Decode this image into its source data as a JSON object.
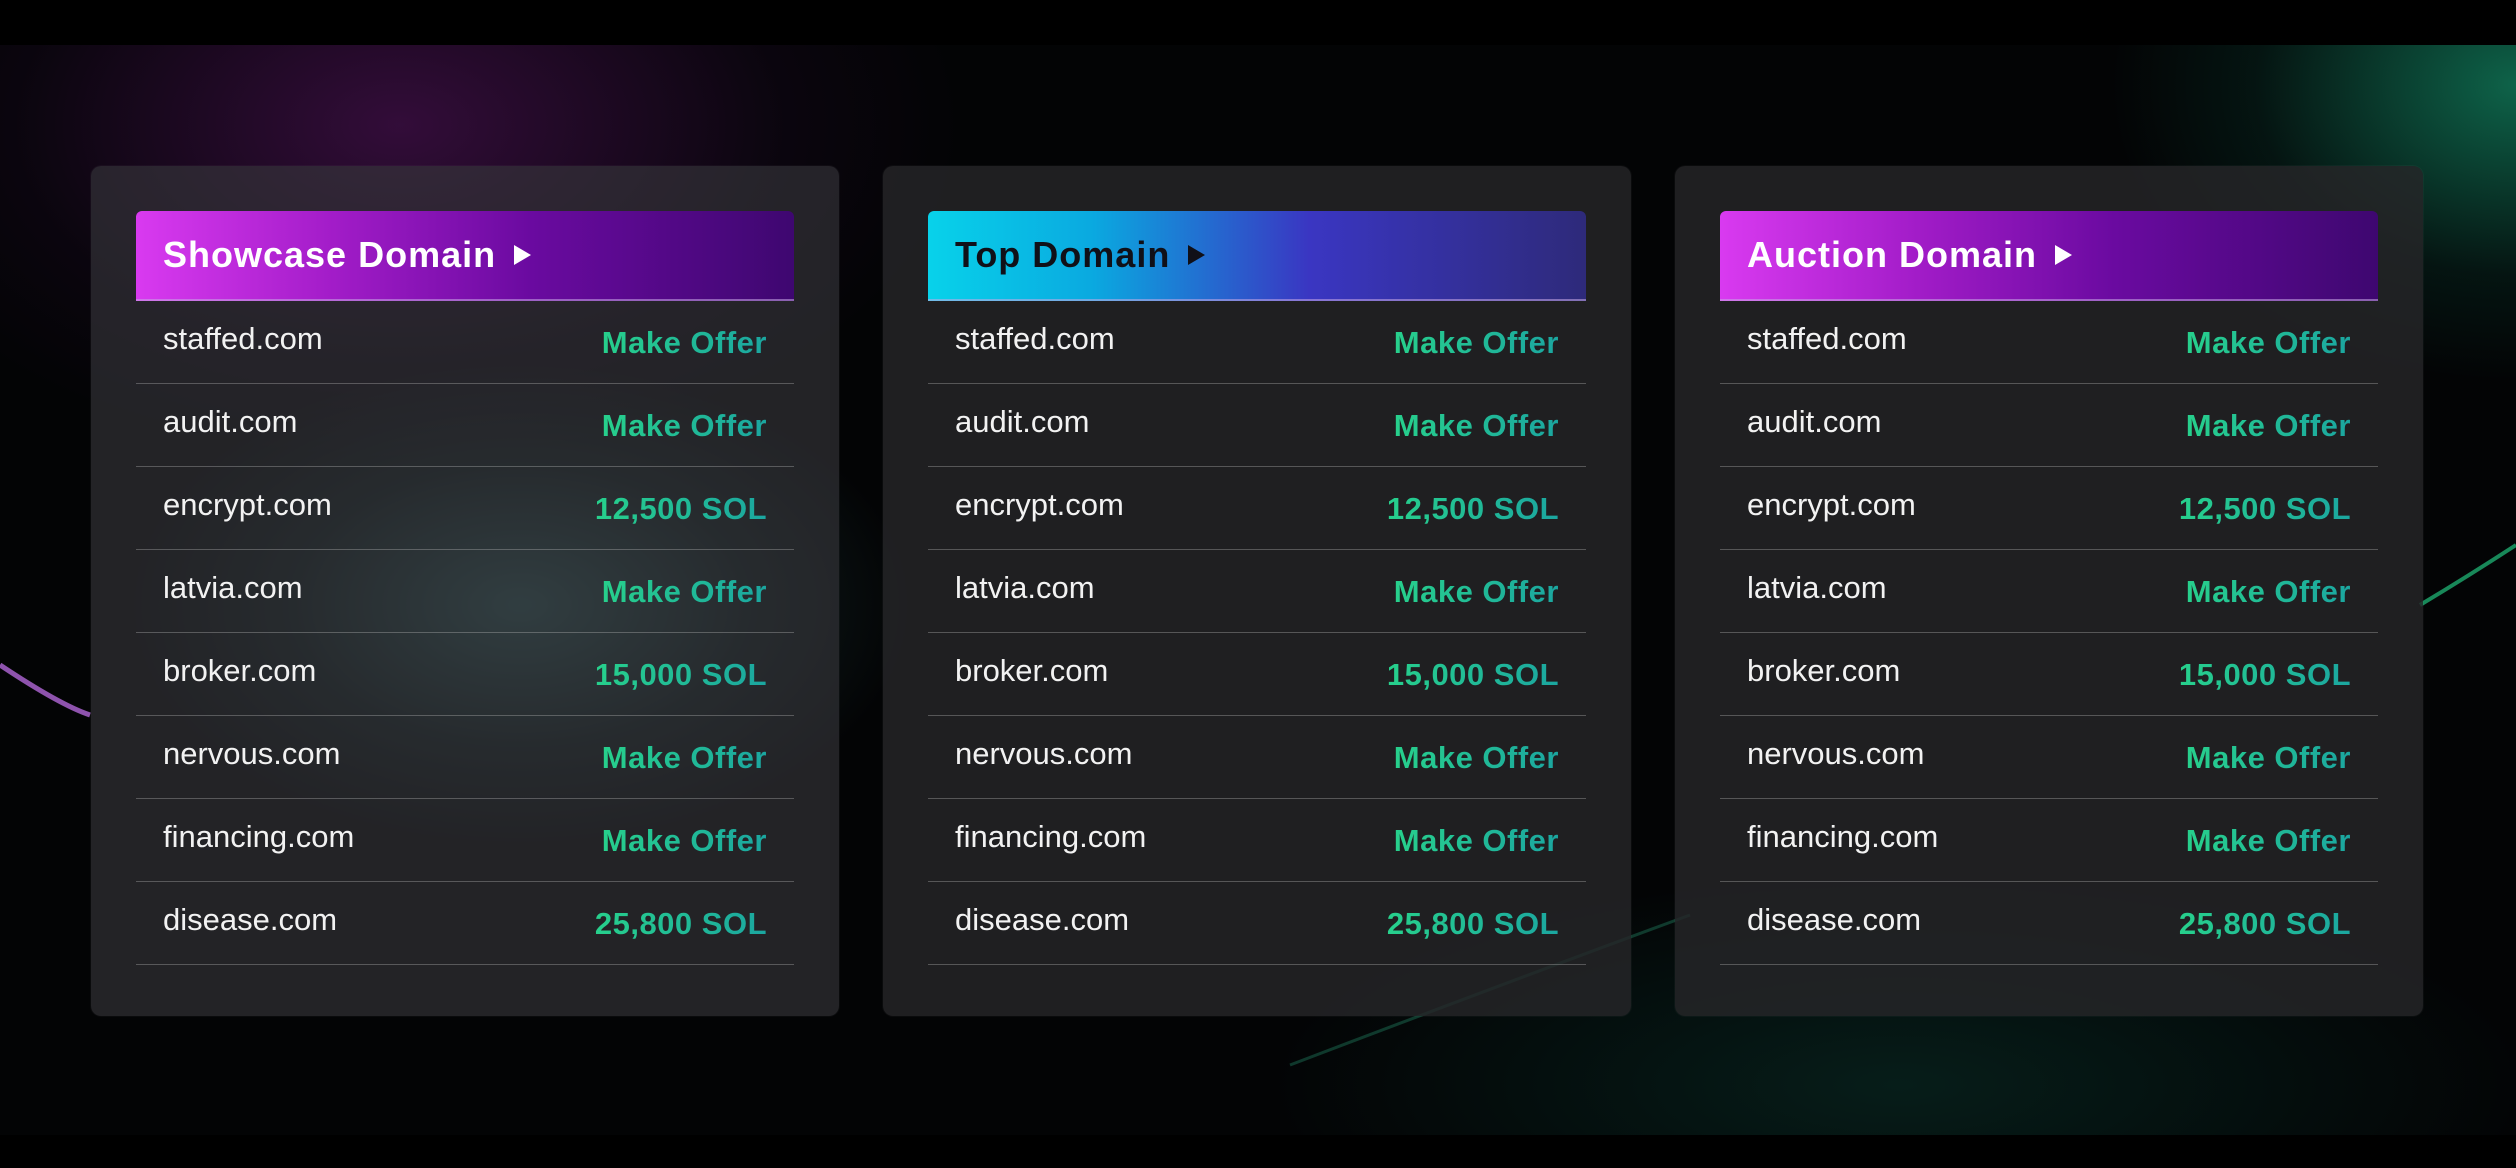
{
  "colors": {
    "background": "#000000",
    "panel": "#262628",
    "price_accent": "#27d08c",
    "header_magenta": "#d93af0",
    "header_cyan": "#08d2ea"
  },
  "panels": [
    {
      "title": "Showcase Domain",
      "icon": "play-arrow-icon",
      "theme": "magenta",
      "rows": [
        {
          "domain": "staffed.com",
          "price": "Make Offer"
        },
        {
          "domain": "audit.com",
          "price": "Make Offer"
        },
        {
          "domain": "encrypt.com",
          "price": "12,500 SOL"
        },
        {
          "domain": "latvia.com",
          "price": "Make Offer"
        },
        {
          "domain": "broker.com",
          "price": "15,000 SOL"
        },
        {
          "domain": "nervous.com",
          "price": "Make Offer"
        },
        {
          "domain": "financing.com",
          "price": "Make Offer"
        },
        {
          "domain": "disease.com",
          "price": "25,800 SOL"
        }
      ]
    },
    {
      "title": "Top Domain",
      "icon": "play-arrow-icon",
      "theme": "cyan",
      "rows": [
        {
          "domain": "staffed.com",
          "price": "Make Offer"
        },
        {
          "domain": "audit.com",
          "price": "Make Offer"
        },
        {
          "domain": "encrypt.com",
          "price": "12,500 SOL"
        },
        {
          "domain": "latvia.com",
          "price": "Make Offer"
        },
        {
          "domain": "broker.com",
          "price": "15,000 SOL"
        },
        {
          "domain": "nervous.com",
          "price": "Make Offer"
        },
        {
          "domain": "financing.com",
          "price": "Make Offer"
        },
        {
          "domain": "disease.com",
          "price": "25,800 SOL"
        }
      ]
    },
    {
      "title": "Auction Domain",
      "icon": "play-arrow-icon",
      "theme": "magenta",
      "rows": [
        {
          "domain": "staffed.com",
          "price": "Make Offer"
        },
        {
          "domain": "audit.com",
          "price": "Make Offer"
        },
        {
          "domain": "encrypt.com",
          "price": "12,500 SOL"
        },
        {
          "domain": "latvia.com",
          "price": "Make Offer"
        },
        {
          "domain": "broker.com",
          "price": "15,000 SOL"
        },
        {
          "domain": "nervous.com",
          "price": "Make Offer"
        },
        {
          "domain": "financing.com",
          "price": "Make Offer"
        },
        {
          "domain": "disease.com",
          "price": "25,800 SOL"
        }
      ]
    }
  ]
}
